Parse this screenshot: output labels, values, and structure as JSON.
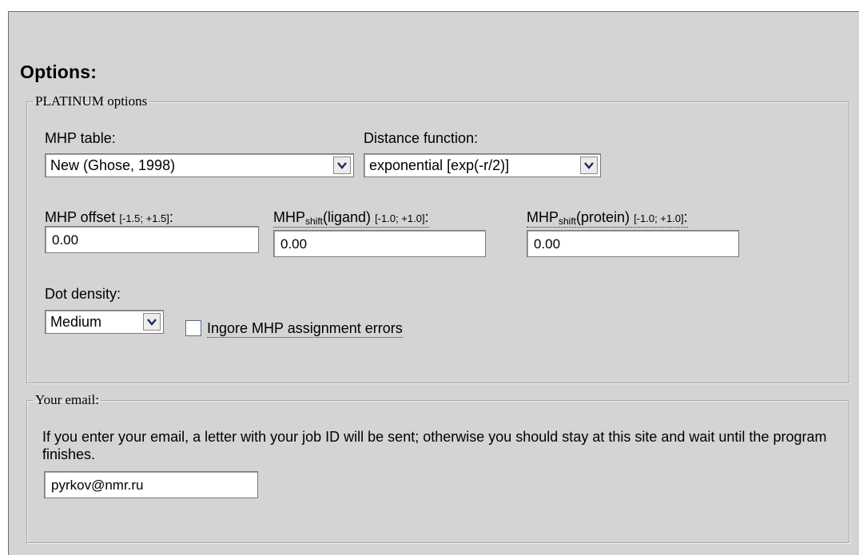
{
  "options": {
    "title": "Options:"
  },
  "platinum": {
    "legend": "PLATINUM options",
    "mhp_table": {
      "label": "MHP table:",
      "value": "New (Ghose, 1998)"
    },
    "distance_function": {
      "label": "Distance function:",
      "value": "exponential [exp(-r/2)]"
    },
    "mhp_offset": {
      "label": "MHP offset",
      "range": "[-1.5;  +1.5]",
      "suffix": ":",
      "value": "0.00"
    },
    "mhp_shift_ligand": {
      "label_main": "MHP",
      "label_sub": "shift",
      "label_tail": "(ligand)",
      "range": "[-1.0;  +1.0]",
      "suffix": ":",
      "value": "0.00"
    },
    "mhp_shift_protein": {
      "label_main": "MHP",
      "label_sub": "shift",
      "label_tail": "(protein)",
      "range": "[-1.0;  +1.0]",
      "suffix": ":",
      "value": "0.00"
    },
    "dot_density": {
      "label": "Dot density:",
      "value": "Medium"
    },
    "ignore_errors": {
      "label": "Ingore MHP assignment errors",
      "checked": false
    }
  },
  "email": {
    "legend": "Your email:",
    "description": "If you enter your email, a letter with your job ID will be sent; otherwise you should stay at this site and wait until the program finishes.",
    "value": "pyrkov@nmr.ru"
  }
}
